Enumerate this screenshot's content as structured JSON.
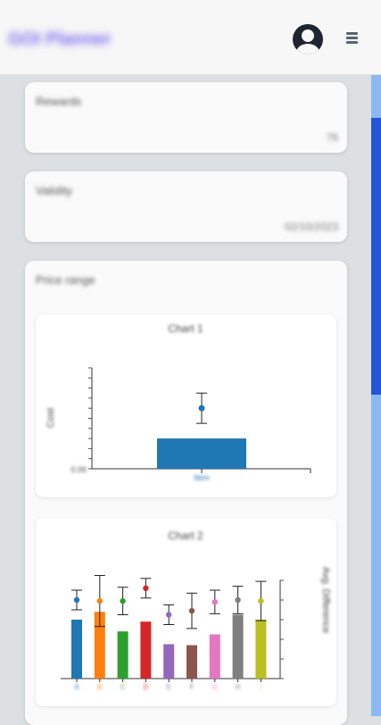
{
  "header": {
    "brand": "GOI Planner",
    "profile_icon": "account-circle-icon",
    "menu_icon": "hamburger-menu-icon"
  },
  "cards": [
    {
      "title": "Rewards",
      "value": "76"
    },
    {
      "title": "Validity",
      "value": "02/10/2023"
    },
    {
      "title": "Price range"
    }
  ],
  "colors": {
    "accent": "#2355d6",
    "scroll_track": "#8ab9f2",
    "bar_blue": "#1f77b4"
  },
  "chart_data": [
    {
      "type": "bar",
      "title": "Chart 1",
      "ylabel": "Cost",
      "categories": [
        "Item"
      ],
      "series": [
        {
          "values": [
            0.3
          ]
        }
      ],
      "points": [
        0.6
      ],
      "error": [
        0.15
      ],
      "ylim": [
        0,
        1
      ],
      "ytick_label": "0.00"
    },
    {
      "type": "bar",
      "title": "Chart 2",
      "ylabel": "Avg. Difference",
      "categories": [
        "A",
        "B",
        "C",
        "D",
        "E",
        "F",
        "G",
        "H",
        "I"
      ],
      "colors": [
        "#1f77b4",
        "#ff7f0e",
        "#2ca02c",
        "#d62728",
        "#9467bd",
        "#8c564b",
        "#e377c2",
        "#7f7f7f",
        "#bcbd22"
      ],
      "values": [
        0.6,
        0.68,
        0.48,
        0.58,
        0.35,
        0.34,
        0.45,
        0.65,
        0.6
      ],
      "points": [
        0.8,
        0.79,
        0.79,
        0.92,
        0.65,
        0.69,
        0.78,
        0.8,
        0.79
      ],
      "error": [
        0.1,
        0.26,
        0.14,
        0.1,
        0.1,
        0.18,
        0.12,
        0.14,
        0.2
      ],
      "ylim": [
        0,
        1
      ]
    }
  ]
}
